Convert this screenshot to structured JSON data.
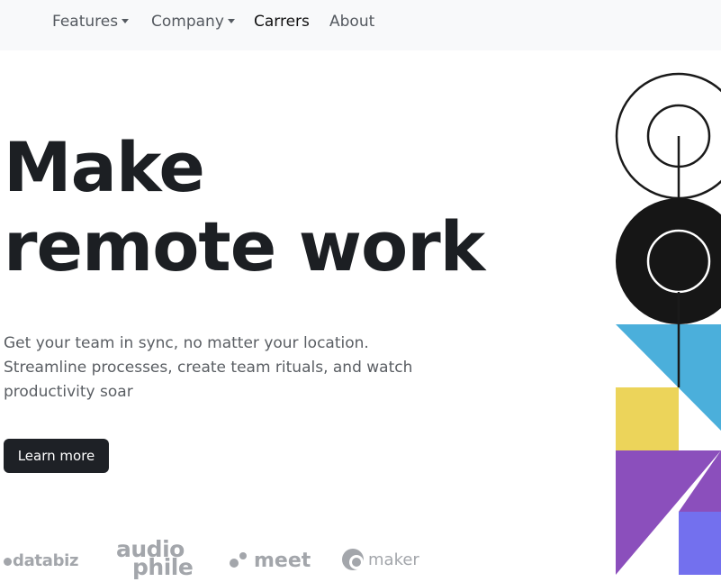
{
  "nav": {
    "items": [
      {
        "label": "Features",
        "dropdown": true
      },
      {
        "label": "Company",
        "dropdown": true
      },
      {
        "label": "Carrers",
        "dropdown": false
      },
      {
        "label": "About",
        "dropdown": false
      }
    ]
  },
  "hero": {
    "title_line1": "Make",
    "title_line2": "remote work",
    "description": "Get your team in sync, no matter your location. Streamline processes, create team rituals, and watch productivity soar",
    "cta_label": "Learn more"
  },
  "clients": {
    "logos": [
      {
        "name": "databiz",
        "text": "databiz"
      },
      {
        "name": "audiophile",
        "text_top": "audio",
        "text_bottom": "phile"
      },
      {
        "name": "meet",
        "text": "meet"
      },
      {
        "name": "maker",
        "text": "maker"
      }
    ]
  },
  "colors": {
    "nav_bg": "#f8f9fa",
    "button_bg": "#1e2126",
    "art_blue": "#4bafdb",
    "art_yellow": "#ecd45a",
    "art_purple": "#8b4fbc",
    "art_indigo": "#7370ee",
    "logo_gray": "#a3a6ab"
  }
}
